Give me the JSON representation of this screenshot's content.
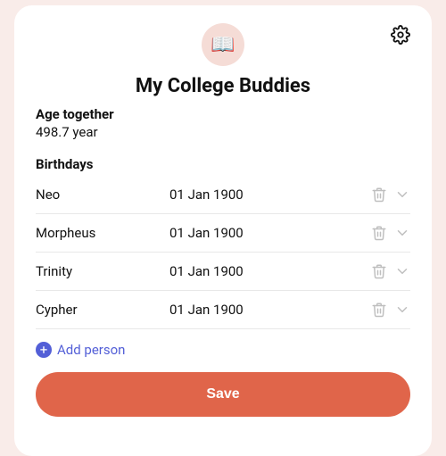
{
  "header": {
    "avatar_emoji": "📖",
    "title": "My College Buddies"
  },
  "age_together": {
    "label": "Age together",
    "value": "498.7 year"
  },
  "birthdays": {
    "label": "Birthdays",
    "items": [
      {
        "name": "Neo",
        "date": "01 Jan 1900"
      },
      {
        "name": "Morpheus",
        "date": "01 Jan 1900"
      },
      {
        "name": "Trinity",
        "date": "01 Jan 1900"
      },
      {
        "name": "Cypher",
        "date": "01 Jan 1900"
      }
    ]
  },
  "add_person_label": "Add person",
  "save_label": "Save"
}
